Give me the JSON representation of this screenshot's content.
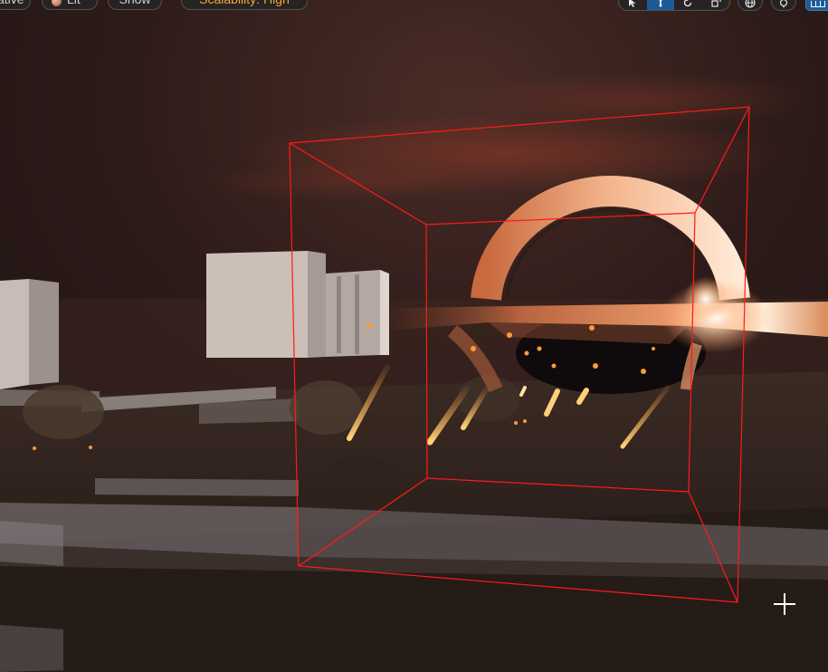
{
  "toolbar": {
    "view_mode_label": "ative",
    "lit_label": "Lit",
    "show_label": "Show",
    "scalability_label": "Scalability:",
    "scalability_value": "High"
  },
  "transform_tools": [
    {
      "icon": "select-arrow-icon",
      "active": false
    },
    {
      "icon": "translate-arrows-icon",
      "active": true
    },
    {
      "icon": "rotate-icon",
      "active": false
    },
    {
      "icon": "scale-icon",
      "active": false
    }
  ],
  "extra_tools": {
    "world_icon": "globe-icon",
    "snap_icon": "surface-snap-icon",
    "layout_icon": "viewport-layout-icon"
  },
  "colors": {
    "selection_box": "#ff1a1a",
    "accent_blue": "#1e5a97",
    "scalability_orange": "#f2a93b"
  }
}
